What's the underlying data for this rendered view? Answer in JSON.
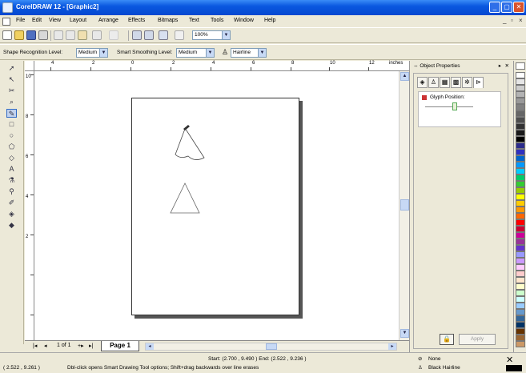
{
  "window": {
    "title": "CorelDRAW 12 - [Graphic2]"
  },
  "menu": {
    "items": [
      "File",
      "Edit",
      "View",
      "Layout",
      "Arrange",
      "Effects",
      "Bitmaps",
      "Text",
      "Tools",
      "Window",
      "Help"
    ]
  },
  "toolbar": {
    "zoom_value": "100%"
  },
  "property_bar": {
    "shape_recognition_label": "Shape Recognition Level:",
    "shape_recognition_value": "Medium",
    "smart_smoothing_label": "Smart Smoothing Level:",
    "smart_smoothing_value": "Medium",
    "outline_width_value": "Hairline"
  },
  "ruler": {
    "units": "inches",
    "h_numbers": [
      "4",
      "2",
      "0",
      "2",
      "4",
      "6",
      "8",
      "10",
      "12"
    ],
    "v_numbers": [
      "10",
      "8",
      "6",
      "4",
      "2"
    ]
  },
  "page_nav": {
    "page_count_text": "1 of 1",
    "page_tab": "Page 1"
  },
  "docker": {
    "title": "Object Properties",
    "glyph_label": "Glyph Position:",
    "apply_label": "Apply"
  },
  "status": {
    "start_end": "Start: (2.700 , 9.490 ) End: (2.522 , 9.236 )",
    "cursor_pos": "( 2.522 , 9.261 )",
    "hint": "Dbl-click opens Smart Drawing Tool options; Shift+drag backwards over line erases",
    "fill_label": "None",
    "outline_label": "Black  Hairline"
  },
  "colors": {
    "titlebar": "#0a58e0",
    "palette": [
      "#ffffff",
      "#e6e6e6",
      "#cccccc",
      "#b3b3b3",
      "#999999",
      "#808080",
      "#666666",
      "#4d4d4d",
      "#333333",
      "#1a1a1a",
      "#000000",
      "#2b2b8c",
      "#3030c0",
      "#0066cc",
      "#0099ff",
      "#00ccff",
      "#00cc66",
      "#33cc33",
      "#99cc00",
      "#ffff00",
      "#ffcc00",
      "#ff9900",
      "#ff6600",
      "#ff0000",
      "#cc0033",
      "#cc0099",
      "#993399",
      "#6633cc",
      "#9999ff",
      "#cc99ff",
      "#ffccff",
      "#ffcccc",
      "#ffe6cc",
      "#ffffcc",
      "#ccffcc",
      "#ccffff",
      "#99ccff",
      "#6699cc",
      "#336699",
      "#003366",
      "#663300",
      "#996633",
      "#cc9966"
    ]
  }
}
